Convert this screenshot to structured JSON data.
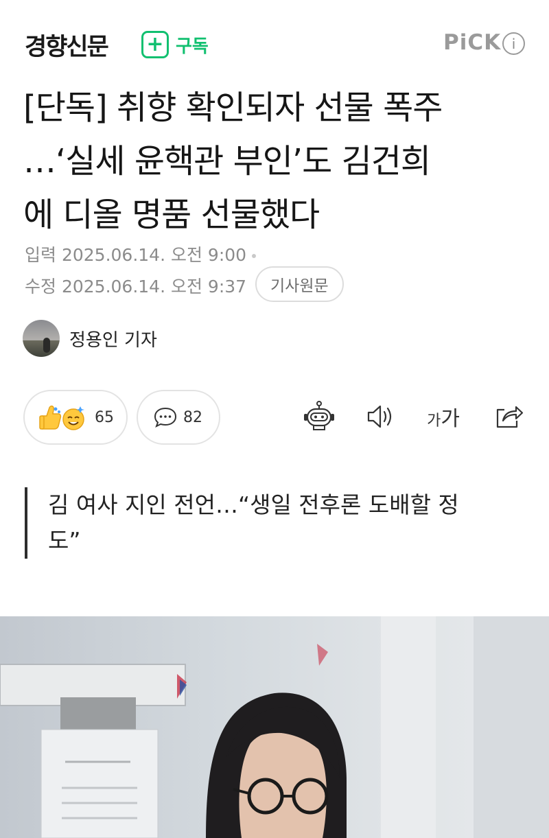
{
  "header": {
    "press_name": "경향신문",
    "subscribe_label": "구독",
    "pick_label": "PiCK",
    "info_label": "i"
  },
  "article": {
    "headline_lines": [
      "[단독] 취향 확인되자 선물 폭주",
      "…‘실세 윤핵관 부인’도 김건희",
      "에 디올 명품 선물했다"
    ],
    "input_time": "입력 2025.06.14. 오전 9:00",
    "edit_time": "수정 2025.06.14. 오전 9:37",
    "source_button": "기사원문",
    "reporter": "정용인 기자",
    "reaction_count": "65",
    "comment_count": "82",
    "subtitle_lines": [
      "김 여사 지인 전언…“생일 전후론 도배할 정",
      "도”"
    ]
  },
  "toolbar": {
    "fontsize_small": "가",
    "fontsize_big": "가"
  },
  "colors": {
    "accent_green": "#11c070",
    "meta_gray": "#8b8b8b"
  },
  "icons": [
    "plus-icon",
    "info-icon",
    "thumbs-up-emoji-icon",
    "happy-face-emoji-icon",
    "comment-icon",
    "robot-summary-icon",
    "speaker-icon",
    "font-size-icon",
    "share-icon"
  ]
}
